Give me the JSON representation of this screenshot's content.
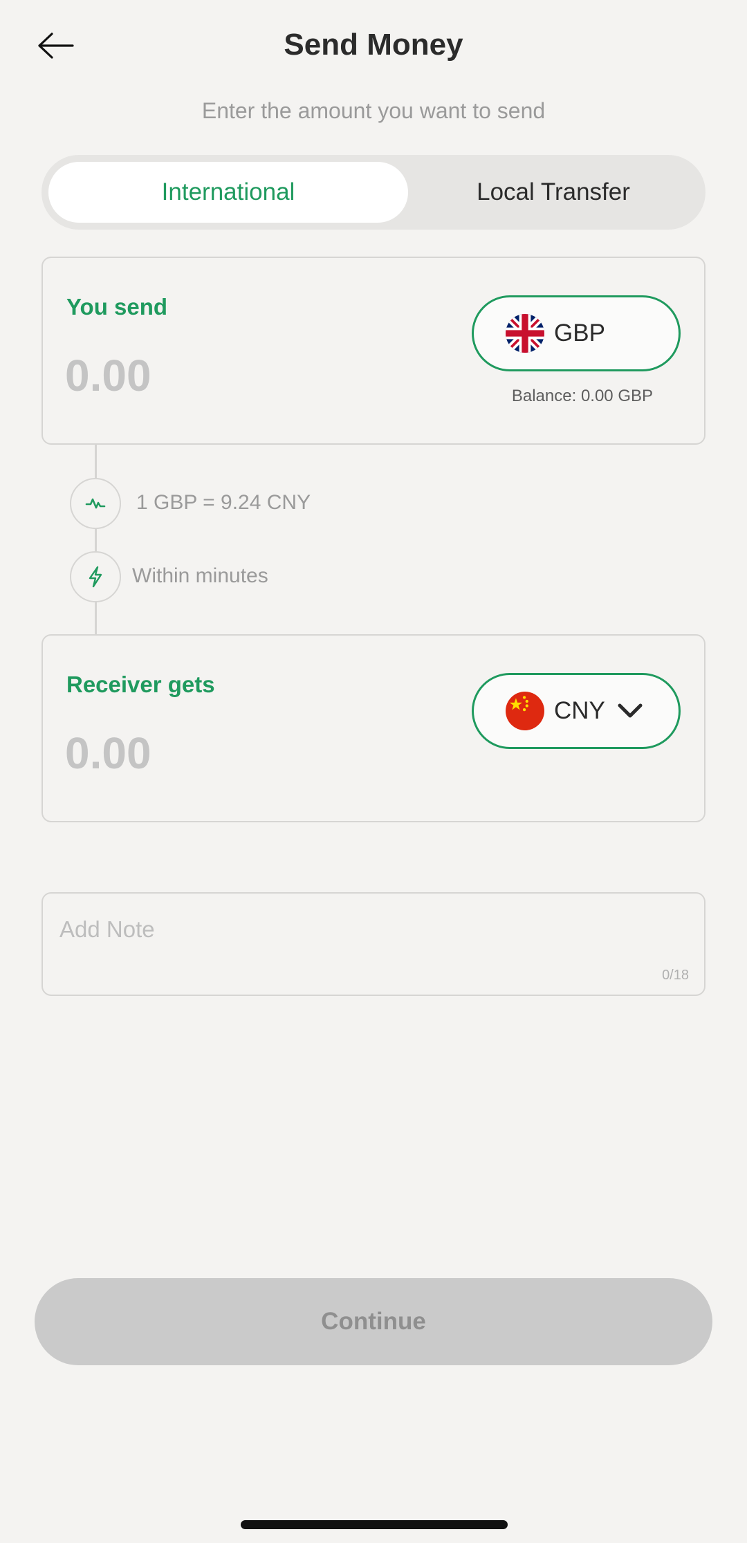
{
  "header": {
    "title": "Send Money",
    "subtitle": "Enter the amount you want to send",
    "back_icon": "arrow-left-icon"
  },
  "tabs": [
    {
      "label": "International",
      "active": true
    },
    {
      "label": "Local Transfer",
      "active": false
    }
  ],
  "send": {
    "label": "You send",
    "amount_placeholder": "0.00",
    "currency": "GBP",
    "flag_icon": "uk-flag-icon",
    "balance_label": "Balance:",
    "balance_value": "0.00 GBP"
  },
  "info": {
    "rate_icon": "exchange-rate-icon",
    "rate": "1 GBP = 9.24 CNY",
    "speed_icon": "lightning-icon",
    "speed": "Within minutes"
  },
  "receive": {
    "label": "Receiver gets",
    "amount_placeholder": "0.00",
    "currency": "CNY",
    "flag_icon": "china-flag-icon",
    "dropdown_icon": "chevron-down-icon"
  },
  "note": {
    "placeholder": "Add Note",
    "counter": "0/18"
  },
  "continue_label": "Continue",
  "colors": {
    "accent": "#1f9a5e",
    "background": "#f4f3f1",
    "disabled_button": "#cacaca"
  }
}
